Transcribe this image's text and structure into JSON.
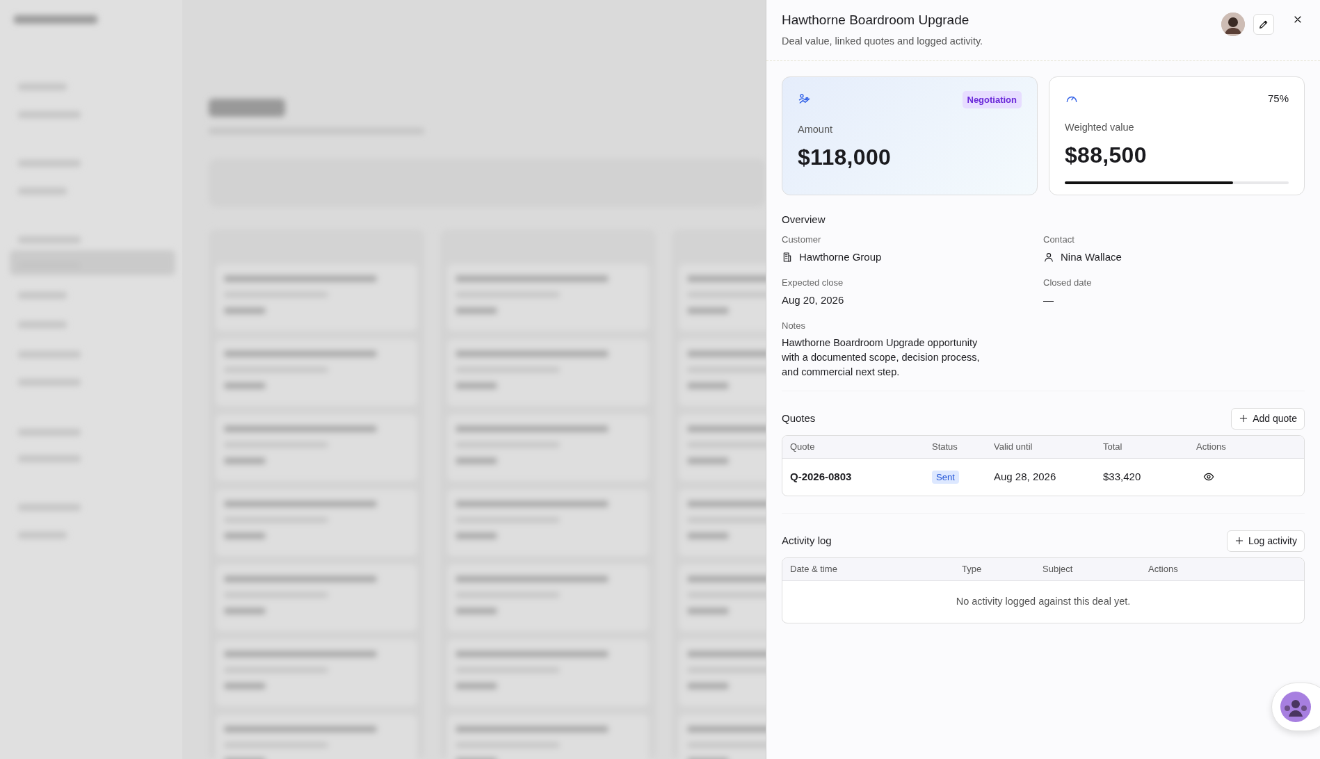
{
  "drawer": {
    "title": "Hawthorne Boardroom Upgrade",
    "subtitle": "Deal value, linked quotes and logged activity."
  },
  "stats": [
    {
      "kind": "amount",
      "label": "Amount",
      "value": "$118,000",
      "badge": "Negotiation"
    },
    {
      "kind": "weighted",
      "label": "Weighted value",
      "value": "$88,500",
      "percent": "75%",
      "level": 0.75
    }
  ],
  "overview": {
    "title": "Overview",
    "fields": [
      {
        "kind": "company",
        "label": "Customer",
        "value": "Hawthorne Group"
      },
      {
        "kind": "person",
        "label": "Contact",
        "value": "Nina Wallace"
      },
      {
        "kind": "plain",
        "label": "Expected close",
        "value": "Aug 20, 2026"
      },
      {
        "kind": "plain",
        "label": "Closed date",
        "value": "—"
      },
      {
        "kind": "notes",
        "label": "Notes",
        "value": "Hawthorne Boardroom Upgrade opportunity with a documented scope, decision process, and commercial next step."
      }
    ]
  },
  "quotes": {
    "title": "Quotes",
    "button": "Add quote",
    "columns": [
      "Quote",
      "Status",
      "Valid until",
      "Total",
      "Actions"
    ],
    "rows": [
      {
        "quote": "Q-2026-0803",
        "status": "Sent",
        "valid_until": "Aug 28, 2026",
        "total": "$33,420"
      }
    ]
  },
  "activity_log": {
    "title": "Activity log",
    "button": "Log activity",
    "columns": [
      "Date & time",
      "Type",
      "Subject",
      "Actions"
    ],
    "empty_message": "No activity logged against this deal yet."
  }
}
